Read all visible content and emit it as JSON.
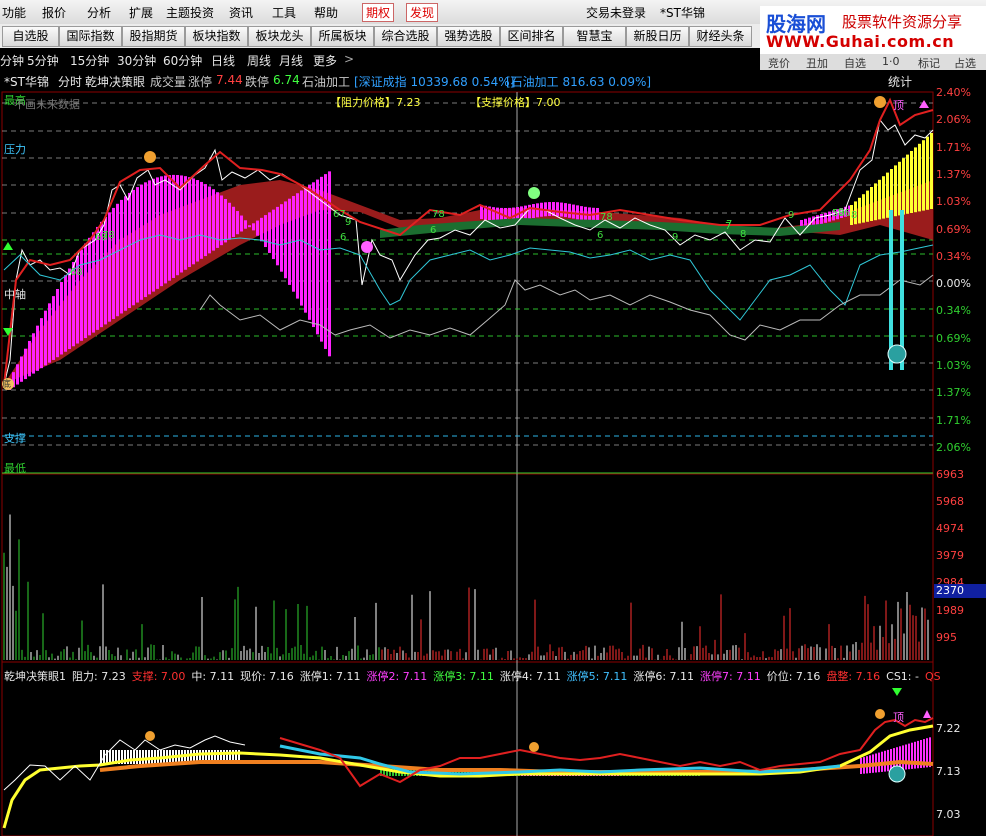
{
  "menu": {
    "items": [
      "功能",
      "报价",
      "分析",
      "扩展",
      "主题投资",
      "资讯",
      "工具",
      "帮助"
    ],
    "highlight1": "期权",
    "highlight2": "发现",
    "login_status": "交易未登录",
    "stock_title": "*ST华锦"
  },
  "toolbar": {
    "buttons": [
      "自选股",
      "国际指数",
      "股指期货",
      "板块指数",
      "板块龙头",
      "所属板块",
      "综合选股",
      "强势选股",
      "区间排名",
      "智慧宝",
      "新股日历",
      "财经头条"
    ]
  },
  "logo": {
    "brand": "股海网",
    "tagline": "股票软件资源分享",
    "url": "WWW.Guhai.com.cn"
  },
  "period": {
    "items": [
      "分钟",
      "5分钟",
      "15分钟",
      "30分钟",
      "60分钟",
      "日线",
      "周线",
      "月线",
      "更多"
    ],
    "arrow": ">"
  },
  "right_tabs": [
    "竞价",
    "丑加",
    "自选",
    "1·0",
    "标记",
    "占选"
  ],
  "info": {
    "stock": "*ST华锦",
    "mode": "分时",
    "indicator": "乾坤决策眼",
    "volume_label": "成交量",
    "limit_up_label": "涨停",
    "limit_up": "7.44",
    "limit_down_label": "跌停",
    "limit_down": "6.74",
    "sector": "石油加工",
    "index_text": "[深证成指 10339.68 0.54%]",
    "sector_text": "[石油加工 816.63 0.09%]",
    "stats": "统计"
  },
  "main_chart": {
    "labels": {
      "highest": "最高",
      "no_future": "不画未来数据",
      "resistance": "压力",
      "middle": "中轴",
      "support": "支撑",
      "lowest": "最低"
    },
    "resistance_price_label": "【阻力价格】7.23",
    "support_price_label": "【支撑价格】7.00",
    "top_label": "顶",
    "bottom_label": "底",
    "pct_axis": [
      "2.40%",
      "2.06%",
      "1.71%",
      "1.37%",
      "1.03%",
      "0.69%",
      "0.34%",
      "0.00%",
      "0.34%",
      "0.69%",
      "1.03%",
      "1.37%",
      "1.71%",
      "2.06%"
    ],
    "marker_numbers": [
      "68",
      "69",
      "78",
      "67",
      "9",
      "6",
      "78",
      "6",
      "78",
      "6",
      "9",
      "7",
      "8",
      "9",
      "58",
      "9",
      "6",
      "8",
      "7"
    ]
  },
  "volume_chart": {
    "axis": [
      "6963",
      "5968",
      "4974",
      "3979",
      "2984",
      "1989",
      "995"
    ],
    "current_volume": "2370"
  },
  "indicator_chart": {
    "legend": [
      {
        "text": "乾坤决策眼1",
        "color": "#e8e8e8"
      },
      {
        "text": "阻力: 7.23",
        "color": "#e8e8e8"
      },
      {
        "text": "支撑: 7.00",
        "color": "#ff3030"
      },
      {
        "text": "中: 7.11",
        "color": "#e8e8e8"
      },
      {
        "text": "现价: 7.16",
        "color": "#e8e8e8"
      },
      {
        "text": "涨停1: 7.11",
        "color": "#e8e8e8"
      },
      {
        "text": "涨停2: 7.11",
        "color": "#ff40ff"
      },
      {
        "text": "涨停3: 7.11",
        "color": "#40ff40"
      },
      {
        "text": "涨停4: 7.11",
        "color": "#e8e8e8"
      },
      {
        "text": "涨停5: 7.11",
        "color": "#40c0ff"
      },
      {
        "text": "涨停6: 7.11",
        "color": "#e8e8e8"
      },
      {
        "text": "涨停7: 7.11",
        "color": "#ff40ff"
      },
      {
        "text": "价位: 7.16",
        "color": "#e8e8e8"
      },
      {
        "text": "盘整: 7.16",
        "color": "#ff3030"
      },
      {
        "text": "CS1: -",
        "color": "#e8e8e8"
      },
      {
        "text": "QS",
        "color": "#ff3030"
      }
    ],
    "axis": [
      "7.22",
      "7.13",
      "7.03"
    ],
    "top_label": "顶"
  },
  "colors": {
    "magenta": "#ff22ff",
    "darkred": "#9a1c1c",
    "yellow": "#ffff30",
    "cyan": "#30c8d8",
    "green": "#00b000"
  }
}
